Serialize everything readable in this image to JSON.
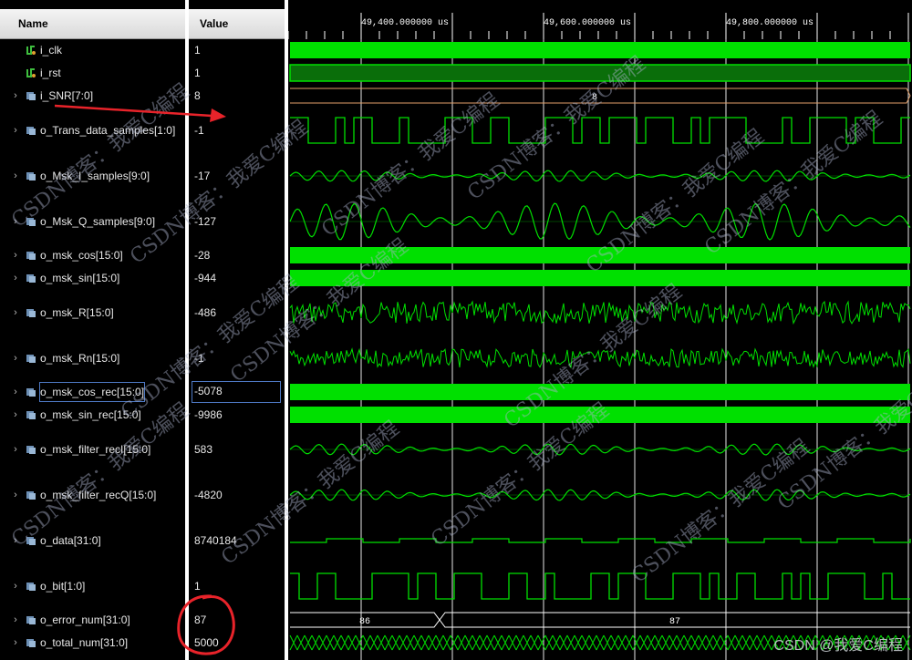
{
  "header": {
    "name_label": "Name",
    "value_label": "Value"
  },
  "timeline": {
    "ticks": [
      "49,400.000000 us",
      "49,600.000000 us",
      "49,800.000000 us"
    ]
  },
  "signals": [
    {
      "id": "i_clk",
      "name": "i_clk",
      "value": "1",
      "expandable": false,
      "icon": "bit-signal-icon",
      "wave": "clock"
    },
    {
      "id": "i_rst",
      "name": "i_rst",
      "value": "1",
      "expandable": false,
      "icon": "bit-signal-icon",
      "wave": "high"
    },
    {
      "id": "i_snr",
      "name": "i_SNR[7:0]",
      "value": "8",
      "expandable": true,
      "icon": "bus-signal-icon",
      "wave": "bus",
      "bus_label": "8"
    },
    {
      "id": "o_trans",
      "name": "o_Trans_data_samples[1:0]",
      "value": "-1",
      "expandable": true,
      "icon": "bus-signal-icon",
      "wave": "digital"
    },
    {
      "id": "o_msk_i",
      "name": "o_Msk_I_samples[9:0]",
      "value": "-17",
      "expandable": true,
      "icon": "bus-signal-icon",
      "wave": "sine_small"
    },
    {
      "id": "o_msk_q",
      "name": "o_Msk_Q_samples[9:0]",
      "value": "-127",
      "expandable": true,
      "icon": "bus-signal-icon",
      "wave": "sine_big"
    },
    {
      "id": "o_msk_cos",
      "name": "o_msk_cos[15:0]",
      "value": "-28",
      "expandable": true,
      "icon": "bus-signal-icon",
      "wave": "solid"
    },
    {
      "id": "o_msk_sin",
      "name": "o_msk_sin[15:0]",
      "value": "-944",
      "expandable": true,
      "icon": "bus-signal-icon",
      "wave": "solid"
    },
    {
      "id": "o_msk_r",
      "name": "o_msk_R[15:0]",
      "value": "-486",
      "expandable": true,
      "icon": "bus-signal-icon",
      "wave": "noise"
    },
    {
      "id": "o_msk_rn",
      "name": "o_msk_Rn[15:0]",
      "value": "-1",
      "expandable": true,
      "icon": "bus-signal-icon",
      "wave": "noise_sparse"
    },
    {
      "id": "o_msk_cos_rec",
      "name": "o_msk_cos_rec[15:0]",
      "value": "-5078",
      "expandable": true,
      "icon": "bus-signal-icon",
      "wave": "solid",
      "selected": true
    },
    {
      "id": "o_msk_sin_rec",
      "name": "o_msk_sin_rec[15:0]",
      "value": "-9986",
      "expandable": true,
      "icon": "bus-signal-icon",
      "wave": "solid"
    },
    {
      "id": "o_msk_filter_reci",
      "name": "o_msk_filter_recI[15:0]",
      "value": "583",
      "expandable": true,
      "icon": "bus-signal-icon",
      "wave": "sine_small"
    },
    {
      "id": "o_msk_filter_recq",
      "name": "o_msk_filter_recQ[15:0]",
      "value": "-4820",
      "expandable": true,
      "icon": "bus-signal-icon",
      "wave": "sine_small"
    },
    {
      "id": "o_data",
      "name": "o_data[31:0]",
      "value": "8740184",
      "expandable": true,
      "icon": "bus-signal-icon",
      "wave": "flat"
    },
    {
      "id": "o_bit",
      "name": "o_bit[1:0]",
      "value": "1",
      "expandable": true,
      "icon": "bus-signal-icon",
      "wave": "digital"
    },
    {
      "id": "o_error_num",
      "name": "o_error_num[31:0]",
      "value": "87",
      "expandable": true,
      "icon": "bus-signal-icon",
      "wave": "bus2",
      "bus_label": "86",
      "bus_label2": "87"
    },
    {
      "id": "o_total_num",
      "name": "o_total_num[31:0]",
      "value": "5000",
      "expandable": true,
      "icon": "bus-signal-icon",
      "wave": "bus_fast"
    }
  ],
  "watermark": {
    "line": "CSDN博客：我爱C编程",
    "corner": "CSDN @我爱C编程"
  },
  "colors": {
    "wave": "#00e000",
    "bus": "#00f000",
    "bus_border": "#e3a06a",
    "annotation": "#e8232a"
  }
}
